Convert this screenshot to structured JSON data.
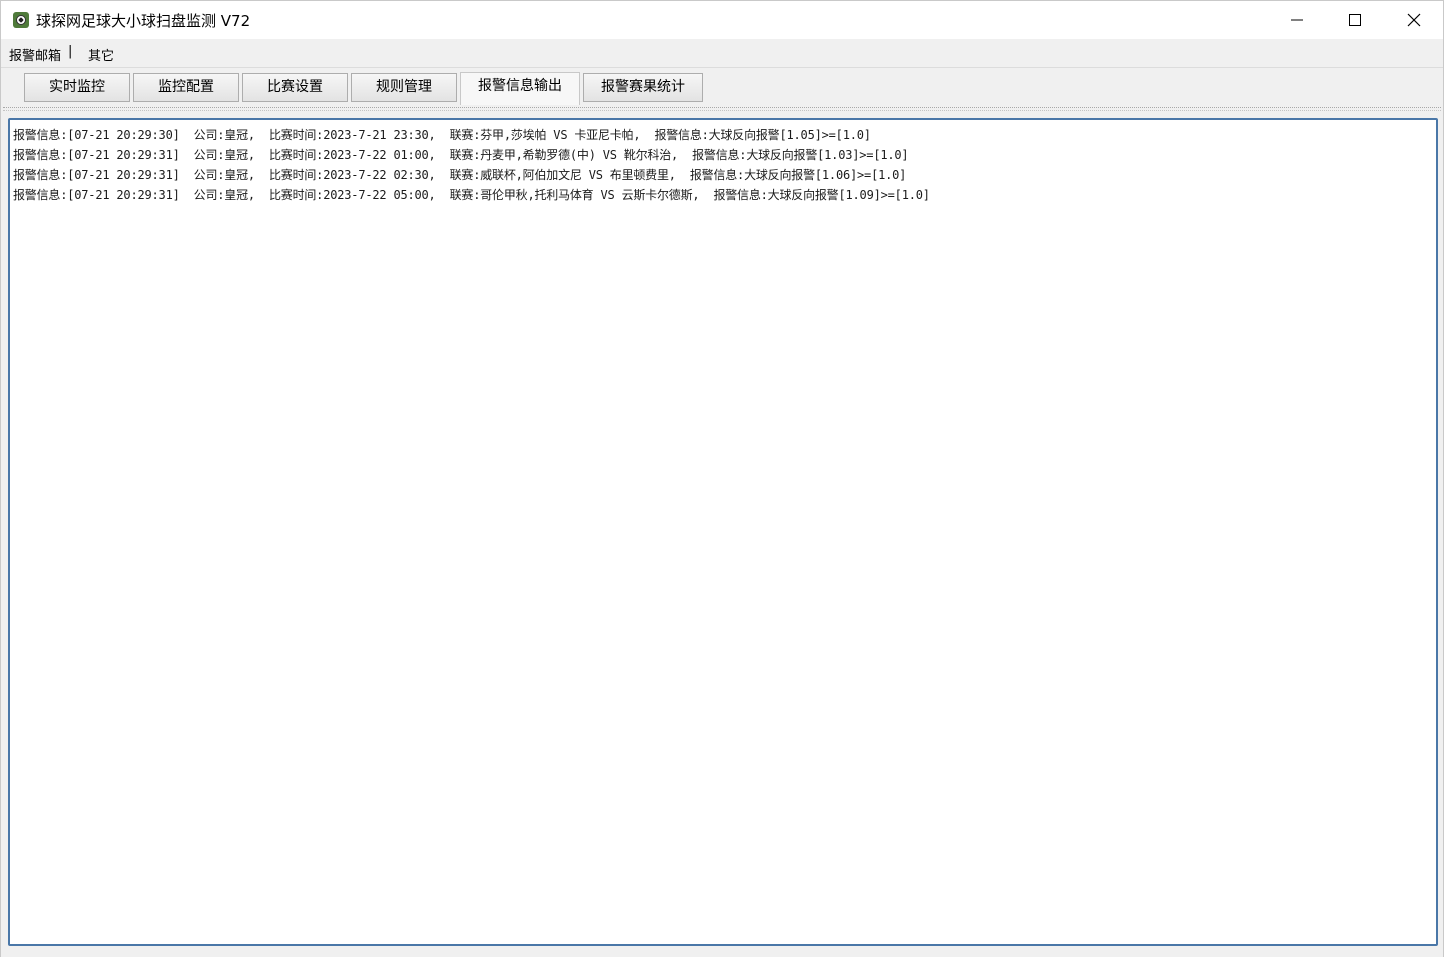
{
  "window": {
    "title": "球探网足球大小球扫盘监测 V72",
    "icon": "soccer-ball-icon"
  },
  "menu": {
    "items": [
      "报警邮箱",
      "其它"
    ],
    "separator": "|"
  },
  "tabs": [
    {
      "label": "实时监控",
      "active": false
    },
    {
      "label": "监控配置",
      "active": false
    },
    {
      "label": "比赛设置",
      "active": false
    },
    {
      "label": "规则管理",
      "active": false
    },
    {
      "label": "报警信息输出",
      "active": true
    },
    {
      "label": "报警赛果统计",
      "active": false
    }
  ],
  "log": {
    "lines": [
      "报警信息:[07-21 20:29:30]  公司:皇冠,  比赛时间:2023-7-21 23:30,  联赛:芬甲,莎埃帕 VS 卡亚尼卡帕,  报警信息:大球反向报警[1.05]>=[1.0]",
      "报警信息:[07-21 20:29:31]  公司:皇冠,  比赛时间:2023-7-22 01:00,  联赛:丹麦甲,希勒罗德(中) VS 靴尔科治,  报警信息:大球反向报警[1.03]>=[1.0]",
      "报警信息:[07-21 20:29:31]  公司:皇冠,  比赛时间:2023-7-22 02:30,  联赛:威联杯,阿伯加文尼 VS 布里顿费里,  报警信息:大球反向报警[1.06]>=[1.0]",
      "报警信息:[07-21 20:29:31]  公司:皇冠,  比赛时间:2023-7-22 05:00,  联赛:哥伦甲秋,托利马体育 VS 云斯卡尔德斯,  报警信息:大球反向报警[1.09]>=[1.0]"
    ]
  },
  "colors": {
    "log_border": "#4a77a8",
    "window_bg": "#f0f0f0"
  }
}
